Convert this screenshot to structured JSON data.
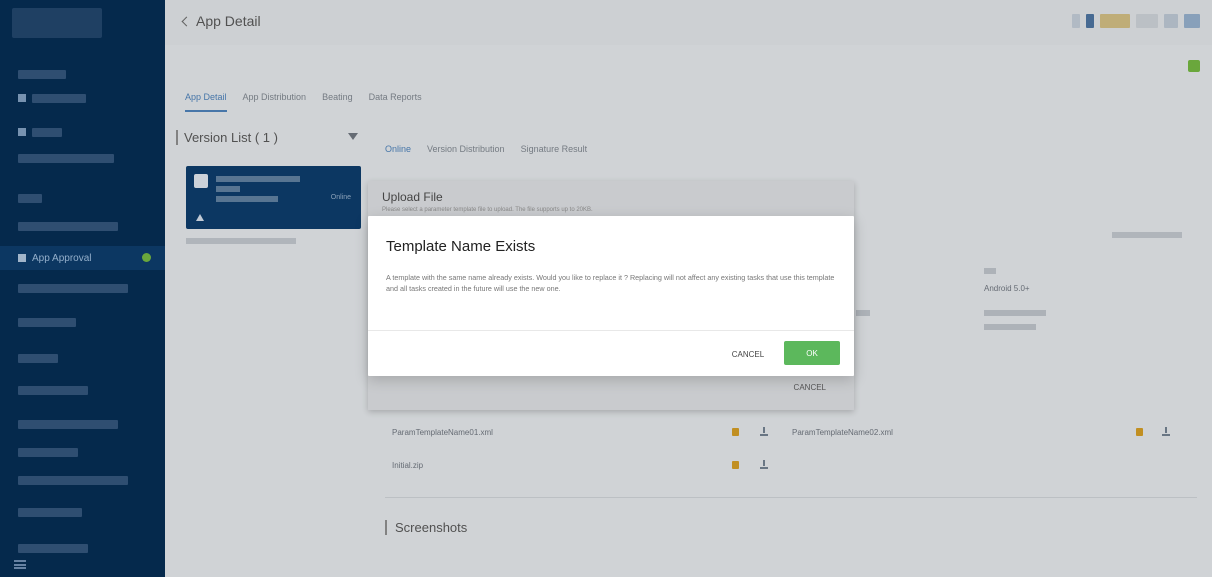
{
  "header": {
    "back_label": "App Detail"
  },
  "sidebar": {
    "active_item_label": "App Approval"
  },
  "app_tabs": [
    "App Detail",
    "App Distribution",
    "Beating",
    "Data Reports"
  ],
  "version_list": {
    "title": "Version List ( 1 )",
    "card_status": "Online"
  },
  "sub_tabs": [
    "Online",
    "Version Distribution",
    "Signature Result"
  ],
  "details": {
    "os_value": "Android 5.0+"
  },
  "upload_dialog": {
    "title": "Upload File",
    "subtitle": "Please select a parameter template file to upload. The file supports up to 20KB.",
    "cancel_label": "CANCEL"
  },
  "files": [
    {
      "name": "ParamTemplateName01.xml"
    },
    {
      "name": "ParamTemplateName02.xml"
    },
    {
      "name": "Initial.zip"
    }
  ],
  "screenshots_title": "Screenshots",
  "modal": {
    "title": "Template Name Exists",
    "body": "A template with the same name already exists. Would you like to replace it ? Replacing will not affect any existing tasks that use this template and all tasks created in the future will use the new one.",
    "cancel_label": "CANCEL",
    "ok_label": "OK"
  },
  "colors": {
    "sidebar_bg": "#062b50",
    "ok_button": "#5cb85c",
    "accent": "#4a7bb0",
    "lock": "#c99524"
  }
}
